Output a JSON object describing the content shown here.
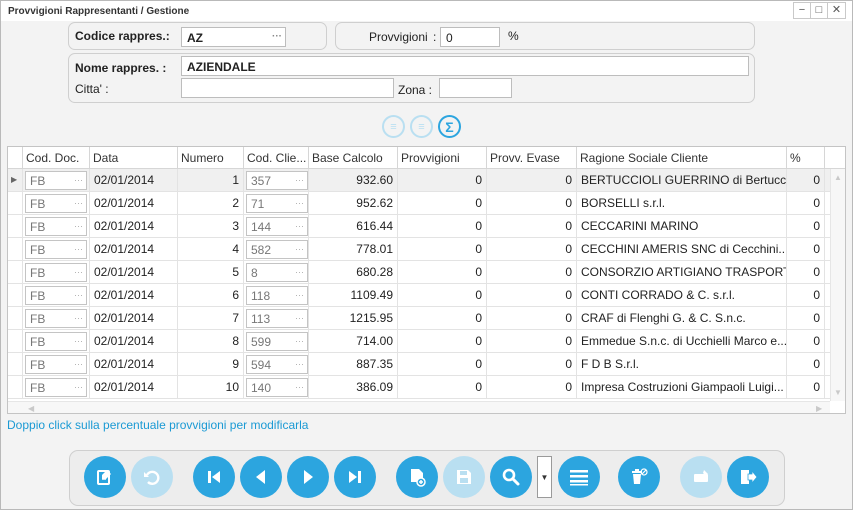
{
  "window": {
    "title": "Provvigioni Rappresentanti / Gestione",
    "buttons": [
      "−",
      "□",
      "✕"
    ]
  },
  "form": {
    "codice_label": "Codice rappres.:",
    "codice_value": "AZ",
    "codice_dots": "···",
    "provvigioni_label": "Provvigioni",
    "provvigioni_colon": ":",
    "provvigioni_value": "0",
    "provvigioni_unit": "%",
    "nome_label": "Nome rappres. :",
    "nome_value": "AZIENDALE",
    "citta_label": "Citta' :",
    "citta_value": "",
    "zona_label": "Zona :",
    "zona_value": ""
  },
  "tool_icons": [
    "list-edit-icon",
    "list-remove-icon",
    "sum-icon"
  ],
  "grid": {
    "columns": [
      "Cod. Doc.",
      "Data",
      "Numero",
      "Cod. Clie...",
      "Base Calcolo",
      "Provvigioni",
      "Provv. Evase",
      "Ragione Sociale Cliente",
      "%"
    ],
    "rows": [
      {
        "cod_doc": "FB",
        "data": "02/01/2014",
        "numero": "1",
        "cod_cliente": "357",
        "base": "932.60",
        "provv": "0",
        "evase": "0",
        "ragione": "BERTUCCIOLI GUERRINO di Bertucci...",
        "perc": "0"
      },
      {
        "cod_doc": "FB",
        "data": "02/01/2014",
        "numero": "2",
        "cod_cliente": "71",
        "base": "952.62",
        "provv": "0",
        "evase": "0",
        "ragione": "BORSELLI s.r.l.",
        "perc": "0"
      },
      {
        "cod_doc": "FB",
        "data": "02/01/2014",
        "numero": "3",
        "cod_cliente": "144",
        "base": "616.44",
        "provv": "0",
        "evase": "0",
        "ragione": "CECCARINI MARINO",
        "perc": "0"
      },
      {
        "cod_doc": "FB",
        "data": "02/01/2014",
        "numero": "4",
        "cod_cliente": "582",
        "base": "778.01",
        "provv": "0",
        "evase": "0",
        "ragione": "CECCHINI AMERIS SNC di Cecchini...",
        "perc": "0"
      },
      {
        "cod_doc": "FB",
        "data": "02/01/2014",
        "numero": "5",
        "cod_cliente": "8",
        "base": "680.28",
        "provv": "0",
        "evase": "0",
        "ragione": "CONSORZIO ARTIGIANO TRASPORT...",
        "perc": "0"
      },
      {
        "cod_doc": "FB",
        "data": "02/01/2014",
        "numero": "6",
        "cod_cliente": "118",
        "base": "1109.49",
        "provv": "0",
        "evase": "0",
        "ragione": "CONTI CORRADO & C. s.r.l.",
        "perc": "0"
      },
      {
        "cod_doc": "FB",
        "data": "02/01/2014",
        "numero": "7",
        "cod_cliente": "113",
        "base": "1215.95",
        "provv": "0",
        "evase": "0",
        "ragione": "CRAF di Flenghi G. & C. S.n.c.",
        "perc": "0"
      },
      {
        "cod_doc": "FB",
        "data": "02/01/2014",
        "numero": "8",
        "cod_cliente": "599",
        "base": "714.00",
        "provv": "0",
        "evase": "0",
        "ragione": "Emmedue S.n.c. di Ucchielli Marco e...",
        "perc": "0"
      },
      {
        "cod_doc": "FB",
        "data": "02/01/2014",
        "numero": "9",
        "cod_cliente": "594",
        "base": "887.35",
        "provv": "0",
        "evase": "0",
        "ragione": "F D B S.r.l.",
        "perc": "0"
      },
      {
        "cod_doc": "FB",
        "data": "02/01/2014",
        "numero": "10",
        "cod_cliente": "140",
        "base": "386.09",
        "provv": "0",
        "evase": "0",
        "ragione": "Impresa Costruzioni Giampaoli Luigi...",
        "perc": "0"
      }
    ]
  },
  "hint": "Doppio click sulla percentuale provvigioni per modificarla",
  "toolbar": {
    "buttons": [
      {
        "name": "edit-document-icon",
        "enabled": true
      },
      {
        "name": "undo-icon",
        "enabled": false
      },
      {
        "name": "first-record-icon",
        "enabled": true
      },
      {
        "name": "previous-record-icon",
        "enabled": true
      },
      {
        "name": "next-record-icon",
        "enabled": true
      },
      {
        "name": "last-record-icon",
        "enabled": true
      },
      {
        "name": "new-document-icon",
        "enabled": true
      },
      {
        "name": "save-icon",
        "enabled": false
      },
      {
        "name": "search-icon",
        "enabled": true
      },
      {
        "name": "list-icon",
        "enabled": true
      },
      {
        "name": "delete-icon",
        "enabled": true
      },
      {
        "name": "print-icon",
        "enabled": false
      },
      {
        "name": "exit-icon",
        "enabled": true
      }
    ]
  },
  "colors": {
    "accent": "#2ca5df",
    "accent_disabled": "#b9dff1",
    "hint": "#1b9ad4"
  }
}
